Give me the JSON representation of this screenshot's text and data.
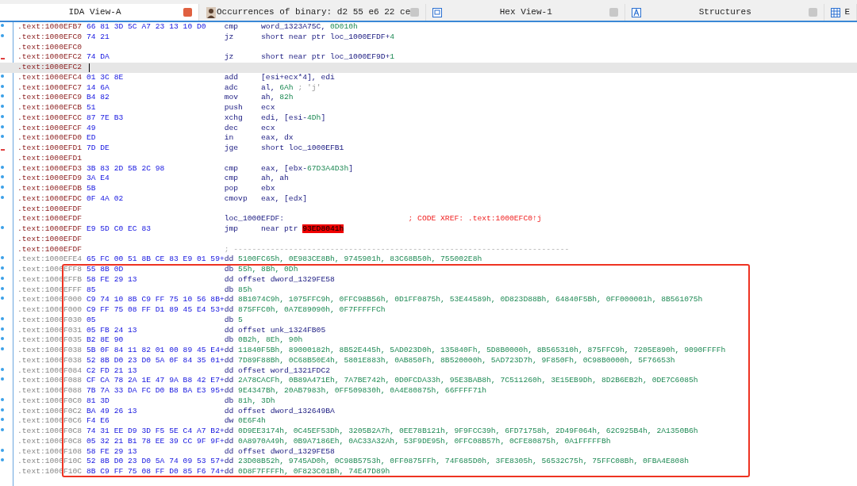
{
  "tabs": [
    {
      "label": "IDA View-A",
      "selected": true,
      "closable": true
    },
    {
      "label": "Occurrences of binary: d2 55 e6 22 ce",
      "selected": false,
      "closable": true
    },
    {
      "label": "Hex View-1",
      "selected": false,
      "closable": true
    },
    {
      "label": "Structures",
      "selected": false,
      "closable": true
    },
    {
      "label": "E",
      "selected": false,
      "closable": false
    }
  ],
  "highlight_box_shown": true,
  "rows": [
    {
      "kind": "instr",
      "marked": true,
      "jump_source": false,
      "selected": false,
      "address": ".text:1000EFB7",
      "bytes": "66 81 3D 5C A7 23 13 10 D0",
      "mnemonic": "cmp",
      "operands": [
        {
          "kind": "name",
          "text": "word_1323A75C, "
        },
        {
          "kind": "num",
          "text": "0D010h"
        }
      ]
    },
    {
      "kind": "instr",
      "marked": true,
      "jump_source": false,
      "selected": false,
      "address": ".text:1000EFC0",
      "bytes": "74 21",
      "mnemonic": "jz",
      "operands": [
        {
          "kind": "name",
          "text": "short near ptr loc_1000EFDF+"
        },
        {
          "kind": "num",
          "text": "4"
        }
      ]
    },
    {
      "kind": "blank",
      "marked": false,
      "jump_source": false,
      "selected": false,
      "address": ".text:1000EFC0"
    },
    {
      "kind": "instr",
      "marked": false,
      "jump_source": true,
      "selected": false,
      "address": ".text:1000EFC2",
      "bytes": "74 DA",
      "mnemonic": "jz",
      "operands": [
        {
          "kind": "name",
          "text": "short near ptr loc_1000EF9D+"
        },
        {
          "kind": "num",
          "text": "1"
        }
      ]
    },
    {
      "kind": "blank",
      "marked": false,
      "jump_source": false,
      "selected": true,
      "address": ".text:1000EFC2"
    },
    {
      "kind": "instr",
      "marked": true,
      "jump_source": false,
      "selected": false,
      "address": ".text:1000EFC4",
      "bytes": "01 3C 8E",
      "mnemonic": "add",
      "operands": [
        {
          "kind": "name",
          "text": "[esi+ecx*4], edi"
        }
      ]
    },
    {
      "kind": "instr",
      "marked": true,
      "jump_source": false,
      "selected": false,
      "address": ".text:1000EFC7",
      "bytes": "14 6A",
      "mnemonic": "adc",
      "operands": [
        {
          "kind": "name",
          "text": "al, "
        },
        {
          "kind": "num",
          "text": "6Ah"
        },
        {
          "kind": "note",
          "text": " ; 'j'"
        }
      ]
    },
    {
      "kind": "instr",
      "marked": true,
      "jump_source": false,
      "selected": false,
      "address": ".text:1000EFC9",
      "bytes": "B4 82",
      "mnemonic": "mov",
      "operands": [
        {
          "kind": "name",
          "text": "ah, "
        },
        {
          "kind": "num",
          "text": "82h"
        }
      ]
    },
    {
      "kind": "instr",
      "marked": true,
      "jump_source": false,
      "selected": false,
      "address": ".text:1000EFCB",
      "bytes": "51",
      "mnemonic": "push",
      "operands": [
        {
          "kind": "name",
          "text": "ecx"
        }
      ]
    },
    {
      "kind": "instr",
      "marked": true,
      "jump_source": false,
      "selected": false,
      "address": ".text:1000EFCC",
      "bytes": "87 7E B3",
      "mnemonic": "xchg",
      "operands": [
        {
          "kind": "name",
          "text": "edi, [esi-"
        },
        {
          "kind": "num",
          "text": "4Dh"
        },
        {
          "kind": "name",
          "text": "]"
        }
      ]
    },
    {
      "kind": "instr",
      "marked": true,
      "jump_source": false,
      "selected": false,
      "address": ".text:1000EFCF",
      "bytes": "49",
      "mnemonic": "dec",
      "operands": [
        {
          "kind": "name",
          "text": "ecx"
        }
      ]
    },
    {
      "kind": "instr",
      "marked": true,
      "jump_source": false,
      "selected": false,
      "address": ".text:1000EFD0",
      "bytes": "ED",
      "mnemonic": "in",
      "operands": [
        {
          "kind": "name",
          "text": "eax, dx"
        }
      ]
    },
    {
      "kind": "instr",
      "marked": false,
      "jump_source": true,
      "selected": false,
      "address": ".text:1000EFD1",
      "bytes": "7D DE",
      "mnemonic": "jge",
      "operands": [
        {
          "kind": "name",
          "text": "short loc_1000EFB1"
        }
      ]
    },
    {
      "kind": "blank",
      "marked": false,
      "jump_source": false,
      "selected": false,
      "address": ".text:1000EFD1"
    },
    {
      "kind": "instr",
      "marked": true,
      "jump_source": false,
      "selected": false,
      "address": ".text:1000EFD3",
      "bytes": "3B 83 2D 5B 2C 98",
      "mnemonic": "cmp",
      "operands": [
        {
          "kind": "name",
          "text": "eax, [ebx-"
        },
        {
          "kind": "num",
          "text": "67D3A4D3h"
        },
        {
          "kind": "name",
          "text": "]"
        }
      ]
    },
    {
      "kind": "instr",
      "marked": true,
      "jump_source": false,
      "selected": false,
      "address": ".text:1000EFD9",
      "bytes": "3A E4",
      "mnemonic": "cmp",
      "operands": [
        {
          "kind": "name",
          "text": "ah, ah"
        }
      ]
    },
    {
      "kind": "instr",
      "marked": true,
      "jump_source": false,
      "selected": false,
      "address": ".text:1000EFDB",
      "bytes": "5B",
      "mnemonic": "pop",
      "operands": [
        {
          "kind": "name",
          "text": "ebx"
        }
      ]
    },
    {
      "kind": "instr",
      "marked": true,
      "jump_source": false,
      "selected": false,
      "address": ".text:1000EFDC",
      "bytes": "0F 4A 02",
      "mnemonic": "cmovp",
      "operands": [
        {
          "kind": "name",
          "text": "eax, [edx]"
        }
      ]
    },
    {
      "kind": "blank",
      "marked": false,
      "jump_source": false,
      "selected": false,
      "address": ".text:1000EFDF"
    },
    {
      "kind": "label",
      "marked": false,
      "jump_source": false,
      "selected": false,
      "address": ".text:1000EFDF",
      "label": "loc_1000EFDF:",
      "comment": "; CODE XREF: .text:1000EFC0↑j"
    },
    {
      "kind": "instr",
      "marked": true,
      "jump_source": false,
      "selected": false,
      "address": ".text:1000EFDF",
      "bytes": "E9 5D C0 EC 83",
      "mnemonic": "jmp",
      "operands": [
        {
          "kind": "name",
          "text": "near ptr "
        },
        {
          "kind": "error",
          "text": "93ED8041h"
        }
      ]
    },
    {
      "kind": "blank",
      "marked": false,
      "jump_source": false,
      "selected": false,
      "address": ".text:1000EFDF"
    },
    {
      "kind": "separator",
      "marked": false,
      "jump_source": false,
      "selected": false,
      "address": ".text:1000EFDF",
      "comment": "; -------------------------------------------------------------------------"
    },
    {
      "kind": "data",
      "marked": true,
      "jump_source": false,
      "selected": false,
      "address": ".text:1000EFE4",
      "bytes": "65 FC 00 51 8B CE 83 E9 01 59+",
      "mnemonic": "dd",
      "operands": [
        {
          "kind": "num",
          "text": "5100FC65h, 0E983CE8Bh, 9745901h, 83C68B50h, 755002E8h"
        }
      ]
    },
    {
      "kind": "data",
      "marked": true,
      "jump_source": false,
      "selected": false,
      "address": ".text:1000EFF8",
      "bytes": "55 8B 0D",
      "mnemonic": "db",
      "operands": [
        {
          "kind": "num",
          "text": "55h, 8Bh, 0Dh"
        }
      ]
    },
    {
      "kind": "data",
      "marked": true,
      "jump_source": false,
      "selected": false,
      "address": ".text:1000EFFB",
      "bytes": "58 FE 29 13",
      "mnemonic": "dd",
      "operands": [
        {
          "kind": "name",
          "text": "offset dword_1329FE58"
        }
      ]
    },
    {
      "kind": "data",
      "marked": true,
      "jump_source": false,
      "selected": false,
      "address": ".text:1000EFFF",
      "bytes": "85",
      "mnemonic": "db",
      "operands": [
        {
          "kind": "num",
          "text": "85h"
        }
      ]
    },
    {
      "kind": "data",
      "marked": true,
      "jump_source": false,
      "selected": false,
      "address": ".text:1000F000",
      "bytes": "C9 74 10 8B C9 FF 75 10 56 8B+",
      "mnemonic": "dd",
      "operands": [
        {
          "kind": "num",
          "text": "8B1074C9h, 1075FFC9h, 0FFC98B56h, 0D1FF0875h, 53E44589h, 0D823D88Bh, 64840F5Bh, 0FF000001h, 8B561075h"
        }
      ]
    },
    {
      "kind": "data",
      "marked": false,
      "jump_source": false,
      "selected": false,
      "address": ".text:1000F000",
      "bytes": "C9 FF 75 08 FF D1 89 45 E4 53+",
      "mnemonic": "dd",
      "operands": [
        {
          "kind": "num",
          "text": "875FFC0h, 0A7E89090h, 0F7FFFFFCh"
        }
      ]
    },
    {
      "kind": "data",
      "marked": true,
      "jump_source": false,
      "selected": false,
      "address": ".text:1000F030",
      "bytes": "05",
      "mnemonic": "db",
      "operands": [
        {
          "kind": "num",
          "text": "5"
        }
      ]
    },
    {
      "kind": "data",
      "marked": true,
      "jump_source": false,
      "selected": false,
      "address": ".text:1000F031",
      "bytes": "05 FB 24 13",
      "mnemonic": "dd",
      "operands": [
        {
          "kind": "name",
          "text": "offset unk_1324FB05"
        }
      ]
    },
    {
      "kind": "data",
      "marked": true,
      "jump_source": false,
      "selected": false,
      "address": ".text:1000F035",
      "bytes": "B2 8E 90",
      "mnemonic": "db",
      "operands": [
        {
          "kind": "num",
          "text": "0B2h, 8Eh, 90h"
        }
      ]
    },
    {
      "kind": "data",
      "marked": true,
      "jump_source": false,
      "selected": false,
      "address": ".text:1000F038",
      "bytes": "5B 0F 84 11 82 01 00 89 45 E4+",
      "mnemonic": "dd",
      "operands": [
        {
          "kind": "num",
          "text": "11840F5Bh, 89000182h, 8B52E445h, 5AD023D0h, 135840Fh, 5D8B0000h, 8B565310h, 875FFC9h, 7205E890h, 9090FFFFh"
        }
      ]
    },
    {
      "kind": "data",
      "marked": false,
      "jump_source": false,
      "selected": false,
      "address": ".text:1000F038",
      "bytes": "52 8B D0 23 D0 5A 0F 84 35 01+",
      "mnemonic": "dd",
      "operands": [
        {
          "kind": "num",
          "text": "7D89F88Bh, 0C68B50E4h, 5801E883h, 0AB850Fh, 8B520000h, 5AD723D7h, 9F850Fh, 0C98B0000h, 5F76653h"
        }
      ]
    },
    {
      "kind": "data",
      "marked": true,
      "jump_source": false,
      "selected": false,
      "address": ".text:1000F084",
      "bytes": "C2 FD 21 13",
      "mnemonic": "dd",
      "operands": [
        {
          "kind": "name",
          "text": "offset word_1321FDC2"
        }
      ]
    },
    {
      "kind": "data",
      "marked": true,
      "jump_source": false,
      "selected": false,
      "address": ".text:1000F088",
      "bytes": "CF CA 78 2A 1E 47 9A B8 42 E7+",
      "mnemonic": "dd",
      "operands": [
        {
          "kind": "num",
          "text": "2A78CACFh, 0B89A471Eh, 7A7BE742h, 0D0FCDA33h, 95E3BAB8h, 7C511260h, 3E15EB9Dh, 8D2B6EB2h, 0DE7C6085h"
        }
      ]
    },
    {
      "kind": "data",
      "marked": false,
      "jump_source": false,
      "selected": false,
      "address": ".text:1000F088",
      "bytes": "7B 7A 33 DA FC D0 B8 BA E3 95+",
      "mnemonic": "dd",
      "operands": [
        {
          "kind": "num",
          "text": "9E4347Bh, 20AB7983h, 0FF509830h, 0A4E80875h, 66FFFF71h"
        }
      ]
    },
    {
      "kind": "data",
      "marked": true,
      "jump_source": false,
      "selected": false,
      "address": ".text:1000F0C0",
      "bytes": "81 3D",
      "mnemonic": "db",
      "operands": [
        {
          "kind": "num",
          "text": "81h, 3Dh"
        }
      ]
    },
    {
      "kind": "data",
      "marked": true,
      "jump_source": false,
      "selected": false,
      "address": ".text:1000F0C2",
      "bytes": "BA 49 26 13",
      "mnemonic": "dd",
      "operands": [
        {
          "kind": "name",
          "text": "offset dword_132649BA"
        }
      ]
    },
    {
      "kind": "data",
      "marked": true,
      "jump_source": false,
      "selected": false,
      "address": ".text:1000F0C6",
      "bytes": "F4 E6",
      "mnemonic": "dw",
      "operands": [
        {
          "kind": "num",
          "text": "0E6F4h"
        }
      ]
    },
    {
      "kind": "data",
      "marked": true,
      "jump_source": false,
      "selected": false,
      "address": ".text:1000F0C8",
      "bytes": "74 31 EE D9 3D F5 5E C4 A7 B2+",
      "mnemonic": "dd",
      "operands": [
        {
          "kind": "num",
          "text": "0D9EE3174h, 0C45EF53Dh, 3205B2A7h, 0EE78B121h, 9F9FCC39h, 6FD71758h, 2D49F064h, 62C925B4h, 2A1350B6h"
        }
      ]
    },
    {
      "kind": "data",
      "marked": false,
      "jump_source": false,
      "selected": false,
      "address": ".text:1000F0C8",
      "bytes": "05 32 21 B1 78 EE 39 CC 9F 9F+",
      "mnemonic": "dd",
      "operands": [
        {
          "kind": "num",
          "text": "0A8970A49h, 0B9A7186Eh, 0AC33A32Ah, 53F9DE95h, 0FFC08B57h, 0CFE80875h, 0A1FFFFFBh"
        }
      ]
    },
    {
      "kind": "data",
      "marked": true,
      "jump_source": false,
      "selected": false,
      "address": ".text:1000F108",
      "bytes": "58 FE 29 13",
      "mnemonic": "dd",
      "operands": [
        {
          "kind": "name",
          "text": "offset dword_1329FE58"
        }
      ]
    },
    {
      "kind": "data",
      "marked": true,
      "jump_source": false,
      "selected": false,
      "address": ".text:1000F10C",
      "bytes": "52 8B D0 23 D0 5A 74 09 53 57+",
      "mnemonic": "dd",
      "operands": [
        {
          "kind": "num",
          "text": "23D08B52h, 9745AD0h, 0C98B5753h, 0FF0875FFh, 74F685D0h, 3FE8305h, 56532C75h, 75FFC08Bh, 0FBA4E808h"
        }
      ]
    },
    {
      "kind": "data",
      "marked": false,
      "jump_source": false,
      "selected": false,
      "address": ".text:1000F10C",
      "bytes": "8B C9 FF 75 08 FF D0 85 F6 74+",
      "mnemonic": "dd",
      "operands": [
        {
          "kind": "num",
          "text": "0D8F7FFFFh, 0F823C01Bh, 74E47D89h"
        }
      ]
    }
  ]
}
